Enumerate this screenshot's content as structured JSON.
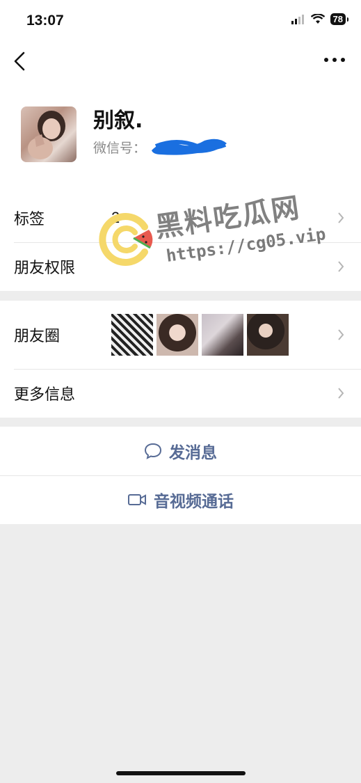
{
  "status": {
    "time": "13:07",
    "battery": "78"
  },
  "profile": {
    "nickname": "别叙.",
    "wechat_id_label": "微信号："
  },
  "rows": {
    "tags_label": "标签",
    "tags_value": "2",
    "permissions_label": "朋友权限",
    "moments_label": "朋友圈",
    "more_info_label": "更多信息"
  },
  "actions": {
    "message_label": "发消息",
    "video_call_label": "音视频通话"
  },
  "watermark": {
    "title": "黑料吃瓜网",
    "url": "https://cg05.vip"
  },
  "colors": {
    "link_blue": "#576b95",
    "background_gray": "#ededed",
    "redaction_blue": "#1a6fe0"
  }
}
